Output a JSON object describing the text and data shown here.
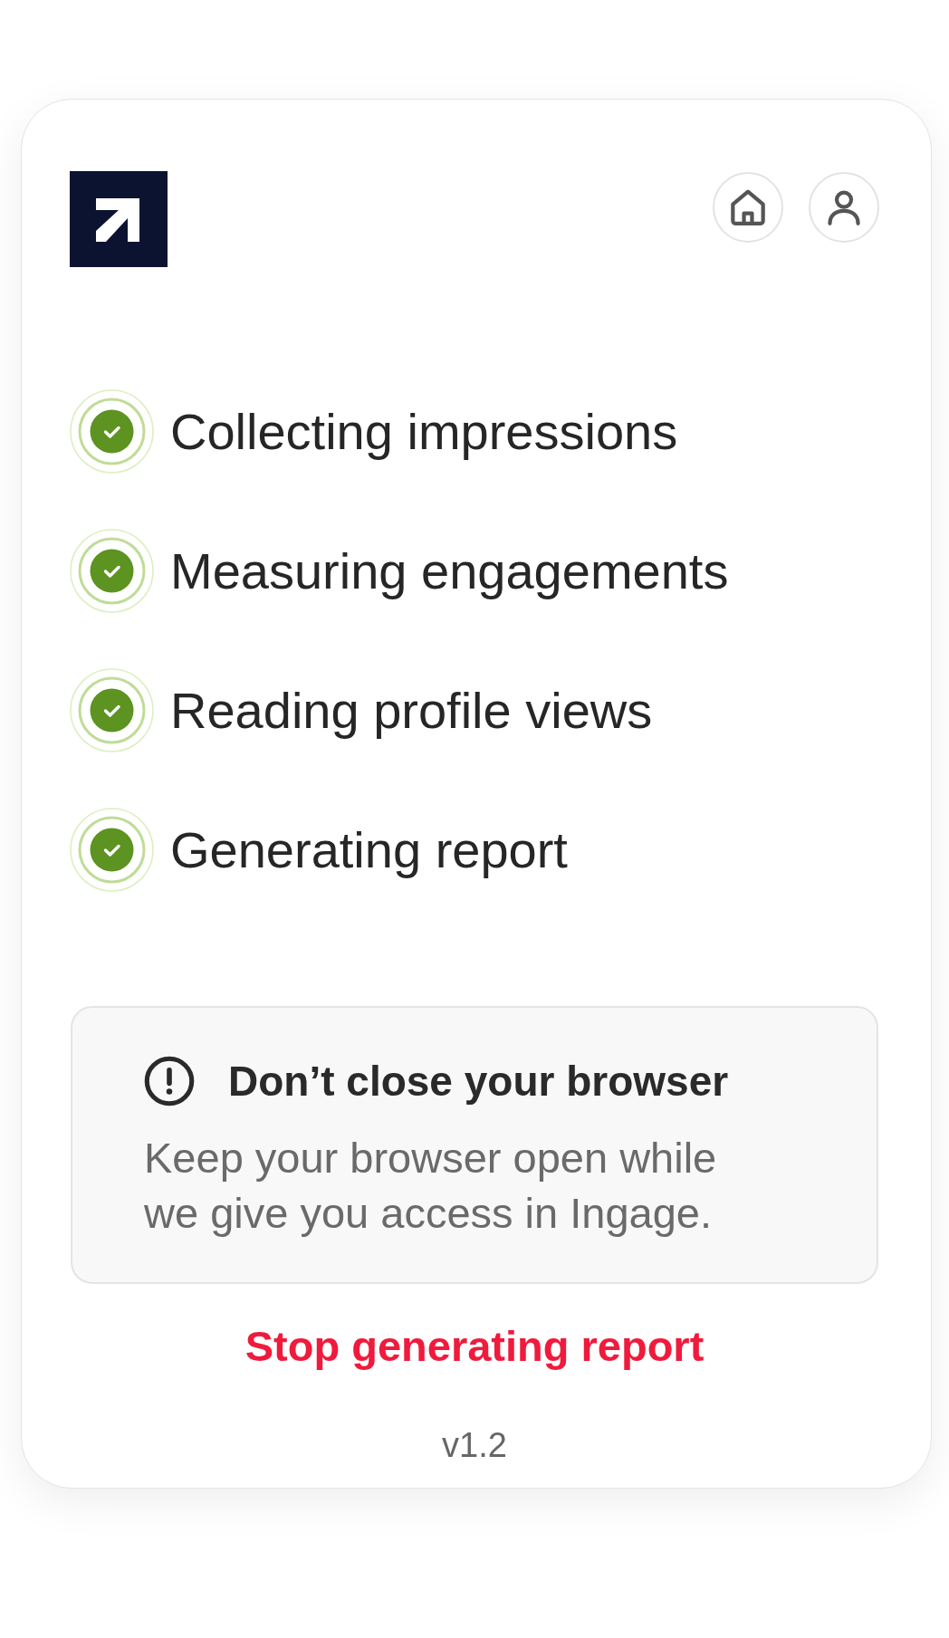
{
  "nav_buttons": [
    {
      "kind": "home"
    },
    {
      "kind": "account"
    }
  ],
  "steps": [
    {
      "label": "Collecting impressions",
      "done": true
    },
    {
      "label": "Measuring engagements",
      "done": true
    },
    {
      "label": "Reading profile views",
      "done": true
    },
    {
      "label": "Generating report",
      "done": true
    }
  ],
  "notice": {
    "title": "Don’t close your browser",
    "message": "Keep your browser open while we give you access in Ingage."
  },
  "stop_link": {
    "label": "Stop generating report"
  },
  "version": "v1.2"
}
